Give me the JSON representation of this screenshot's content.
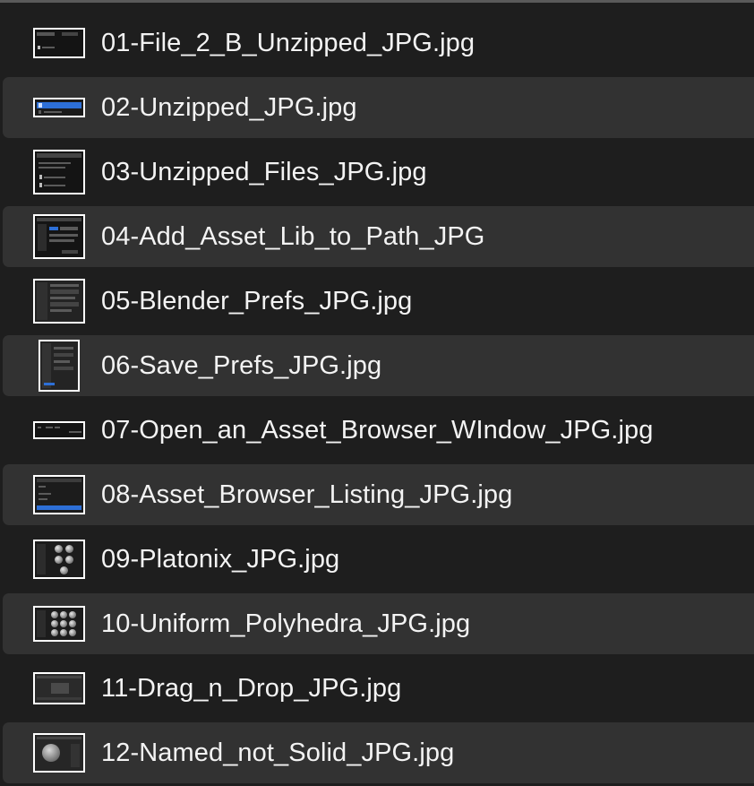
{
  "files": [
    {
      "name": "01-File_2_B_Unzipped_JPG.jpg",
      "icon": "image-thumbnail-icon"
    },
    {
      "name": "02-Unzipped_JPG.jpg",
      "icon": "image-thumbnail-icon"
    },
    {
      "name": "03-Unzipped_Files_JPG.jpg",
      "icon": "image-thumbnail-icon"
    },
    {
      "name": "04-Add_Asset_Lib_to_Path_JPG",
      "icon": "image-thumbnail-icon"
    },
    {
      "name": "05-Blender_Prefs_JPG.jpg",
      "icon": "image-thumbnail-icon"
    },
    {
      "name": "06-Save_Prefs_JPG.jpg",
      "icon": "image-thumbnail-icon"
    },
    {
      "name": "07-Open_an_Asset_Browser_WIndow_JPG.jpg",
      "icon": "image-thumbnail-icon"
    },
    {
      "name": "08-Asset_Browser_Listing_JPG.jpg",
      "icon": "image-thumbnail-icon"
    },
    {
      "name": "09-Platonix_JPG.jpg",
      "icon": "image-thumbnail-icon"
    },
    {
      "name": "10-Uniform_Polyhedra_JPG.jpg",
      "icon": "image-thumbnail-icon"
    },
    {
      "name": "11-Drag_n_Drop_JPG.jpg",
      "icon": "image-thumbnail-icon"
    },
    {
      "name": "12-Named_not_Solid_JPG.jpg",
      "icon": "image-thumbnail-icon"
    }
  ],
  "colors": {
    "background": "#1e1e1e",
    "alternate_row": "#323232",
    "text": "#f3f3f3",
    "accent_blue": "#2d6fd6"
  }
}
